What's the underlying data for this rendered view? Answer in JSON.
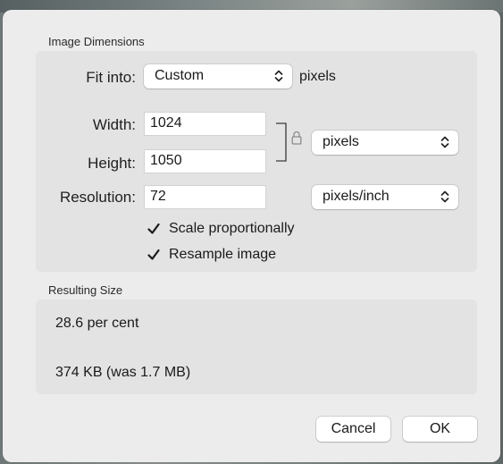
{
  "dimensions": {
    "section_title": "Image Dimensions",
    "fit_into_label": "Fit into:",
    "fit_into_value": "Custom",
    "fit_into_unit": "pixels",
    "width_label": "Width:",
    "width_value": "1024",
    "height_label": "Height:",
    "height_value": "1050",
    "size_unit": "pixels",
    "resolution_label": "Resolution:",
    "resolution_value": "72",
    "resolution_unit": "pixels/inch",
    "scale_proportionally_label": "Scale proportionally",
    "scale_proportionally_checked": true,
    "resample_label": "Resample image",
    "resample_checked": true
  },
  "result": {
    "section_title": "Resulting Size",
    "percent": "28.6 per cent",
    "size": "374 KB (was 1.7 MB)"
  },
  "buttons": {
    "cancel": "Cancel",
    "ok": "OK"
  },
  "icons": {
    "lock": "lock-icon",
    "chevron": "chevron-up-down-icon",
    "checkmark": "checkmark-icon"
  }
}
